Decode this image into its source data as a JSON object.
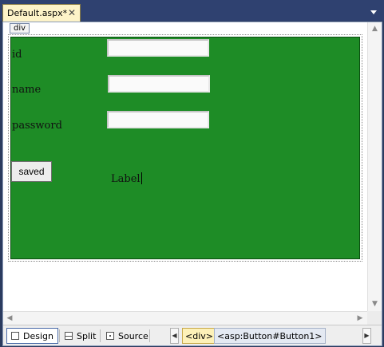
{
  "tab": {
    "title": "Default.aspx*",
    "close_glyph": "✕"
  },
  "designer": {
    "div_tag": "div",
    "fields": [
      {
        "label": "id",
        "value": ""
      },
      {
        "label": "name",
        "value": ""
      },
      {
        "label": "password",
        "value": ""
      }
    ],
    "button_label": "saved",
    "label_text": "Label"
  },
  "bottom_bar": {
    "modes": [
      {
        "label": "Design",
        "icon": "design-view-icon",
        "active": true
      },
      {
        "label": "Split",
        "icon": "split-view-icon",
        "active": false
      },
      {
        "label": "Source",
        "icon": "source-view-icon",
        "active": false
      }
    ],
    "breadcrumbs": [
      "<div>",
      "<asp:Button#Button1>"
    ]
  },
  "colors": {
    "panel_green": "#1e8c26",
    "chrome_blue": "#2f4170",
    "tab_yellow": "#fdf3c8"
  }
}
